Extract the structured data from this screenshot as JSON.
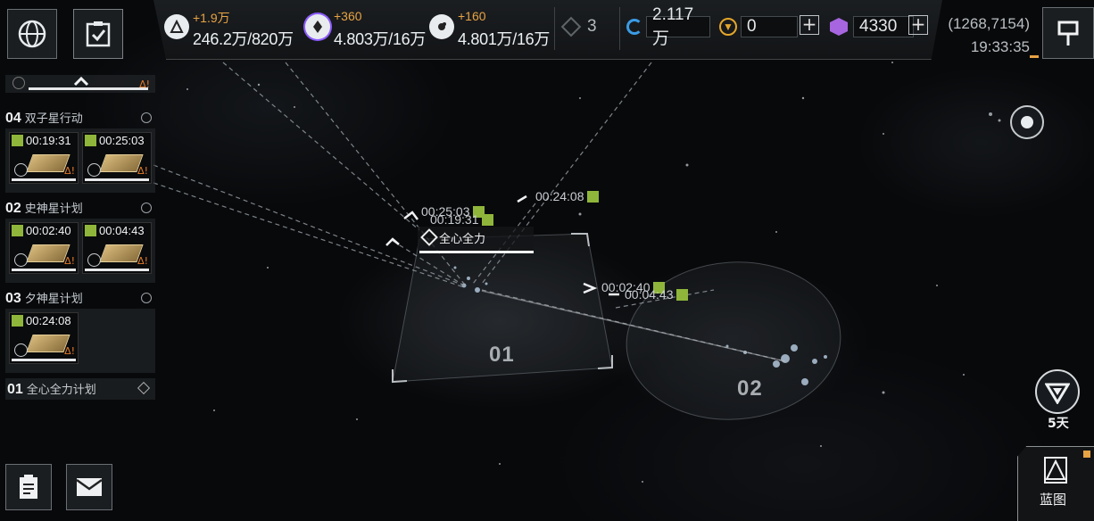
{
  "resources": [
    {
      "icon": "triangle-resource-icon",
      "delta": "+1.9万",
      "amount": "246.2万/820万"
    },
    {
      "icon": "crystal-resource-icon",
      "delta": "+360",
      "amount": "4.803万/16万"
    },
    {
      "icon": "gas-resource-icon",
      "delta": "+160",
      "amount": "4.801万/16万"
    }
  ],
  "fleet_count": "3",
  "currency": {
    "credits": "2.117万",
    "gold": "0",
    "premium": "4330"
  },
  "coords": "(1268,7154)",
  "clock": "19:33:35",
  "tasks": [
    {
      "num": "04",
      "name": "双子星行动",
      "cards": [
        "00:19:31",
        "00:25:03"
      ]
    },
    {
      "num": "02",
      "name": "史神星计划",
      "cards": [
        "00:02:40",
        "00:04:43"
      ]
    },
    {
      "num": "03",
      "name": "夕神星计划",
      "cards": [
        "00:24:08"
      ]
    },
    {
      "num": "01",
      "name": "全心全力计划",
      "cards": []
    }
  ],
  "map": {
    "selected_label": "全心全力",
    "markers": [
      "00:25:03",
      "00:19:31",
      "00:24:08",
      "00:02:40",
      "00:04:43"
    ],
    "zones": [
      "01",
      "02"
    ]
  },
  "right_panel": {
    "days": "5天",
    "blueprint": "蓝图"
  },
  "colors": {
    "accent_orange": "#e7a344",
    "timer_green": "#8fb63a",
    "panel": "#1b1e21"
  }
}
